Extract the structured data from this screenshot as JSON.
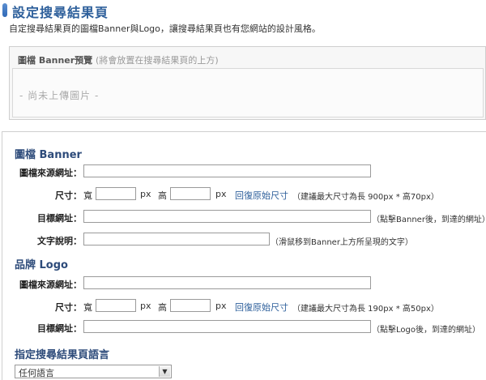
{
  "header": {
    "title": "設定搜尋結果頁",
    "subtitle": "自定搜尋結果頁的圖檔Banner與Logo，讓搜尋結果頁也有您網站的設計風格。"
  },
  "preview": {
    "title": "圖檔 Banner預覽",
    "hint": "(將會放置在搜尋結果頁的上方)",
    "empty_text": "- 尚未上傳圖片 -"
  },
  "banner": {
    "section_title": "圖檔 Banner",
    "source_label": "圖檔來源網址：",
    "size_label": "尺寸：",
    "width_label": "寬",
    "height_label": "高",
    "unit": "px",
    "restore_link": "回復原始尺寸",
    "size_hint": "（建議最大尺寸為長 900px * 高70px）",
    "target_label": "目標網址：",
    "target_hint": "（點擊Banner後，到達的網址）",
    "alt_label": "文字說明：",
    "alt_hint": "（滑鼠移到Banner上方所呈現的文字）",
    "source_value": "",
    "width_value": "",
    "height_value": "",
    "target_value": "",
    "alt_value": ""
  },
  "logo": {
    "section_title": "品牌 Logo",
    "source_label": "圖檔來源網址：",
    "size_label": "尺寸：",
    "width_label": "寬",
    "height_label": "高",
    "unit": "px",
    "restore_link": "回復原始尺寸",
    "size_hint": "（建議最大尺寸為長 190px * 高50px）",
    "target_label": "目標網址：",
    "target_hint": "（點擊Logo後，到達的網址）",
    "source_value": "",
    "width_value": "",
    "height_value": "",
    "target_value": ""
  },
  "language": {
    "section_title": "指定搜尋結果頁語言",
    "selected": "任何語言"
  },
  "colors": {
    "title": "#2d5f9b",
    "section": "#2d4b7a",
    "link": "#2d5f9b",
    "panel_border": "#cfcfcf"
  },
  "icons": {
    "header_marker": "title-bar-icon",
    "dropdown": "chevron-down-icon"
  }
}
